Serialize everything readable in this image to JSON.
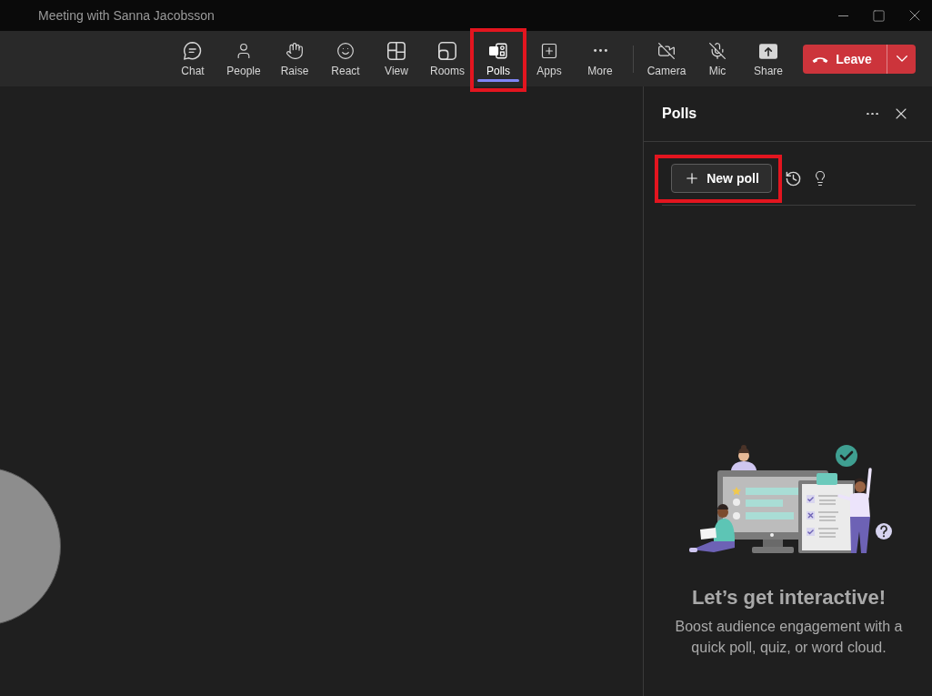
{
  "window": {
    "title": "Meeting with Sanna Jacobsson"
  },
  "toolbar": {
    "items": [
      {
        "label": "Chat",
        "selected": false,
        "highlighted": false
      },
      {
        "label": "People",
        "selected": false,
        "highlighted": false
      },
      {
        "label": "Raise",
        "selected": false,
        "highlighted": false
      },
      {
        "label": "React",
        "selected": false,
        "highlighted": false
      },
      {
        "label": "View",
        "selected": false,
        "highlighted": false
      },
      {
        "label": "Rooms",
        "selected": false,
        "highlighted": false
      },
      {
        "label": "Polls",
        "selected": true,
        "highlighted": true
      },
      {
        "label": "Apps",
        "selected": false,
        "highlighted": false
      },
      {
        "label": "More",
        "selected": false,
        "highlighted": false
      }
    ],
    "devices": [
      {
        "label": "Camera",
        "on": false
      },
      {
        "label": "Mic",
        "on": false
      },
      {
        "label": "Share"
      }
    ],
    "leave_button": {
      "label": "Leave"
    }
  },
  "panel": {
    "title": "Polls",
    "new_poll_button": {
      "label": "New poll",
      "highlighted": true
    },
    "empty_state": {
      "heading": "Let’s get interactive!",
      "text": "Boost audience engagement with a quick poll, quiz, or word cloud."
    }
  }
}
